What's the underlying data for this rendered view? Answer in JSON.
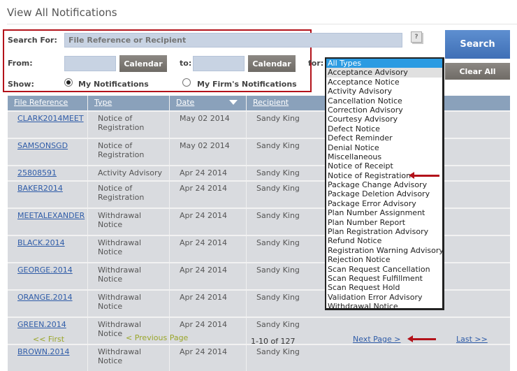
{
  "page": {
    "title": "View All Notifications"
  },
  "search": {
    "search_for_label": "Search For:",
    "placeholder": "File Reference or Recipient",
    "value": "",
    "help_label": "?",
    "from_label": "From:",
    "from_value": "",
    "to_label": "to:",
    "to_value": "",
    "calendar_label": "Calendar",
    "for_label": "for:",
    "show_label": "Show:",
    "show_options": [
      {
        "label": "My Notifications",
        "selected": true
      },
      {
        "label": "My Firm's Notifications",
        "selected": false
      }
    ],
    "search_button": "Search",
    "clear_button": "Clear All"
  },
  "type_dropdown": {
    "selected": "All Types",
    "hovered": "Acceptance Advisory",
    "annotated": "Notice of Registration",
    "options": [
      "All Types",
      "Acceptance Advisory",
      "Acceptance Notice",
      "Activity Advisory",
      "Cancellation Notice",
      "Correction Advisory",
      "Courtesy Advisory",
      "Defect Notice",
      "Defect Reminder",
      "Denial Notice",
      "Miscellaneous",
      "Notice of Receipt",
      "Notice of Registration",
      "Package Change Advisory",
      "Package Deletion Advisory",
      "Package Error Advisory",
      "Plan Number Assignment",
      "Plan Number Report",
      "Plan Registration Advisory",
      "Refund Notice",
      "Registration Warning Advisory",
      "Rejection Notice",
      "Scan Request Cancellation",
      "Scan Request Fulfillment",
      "Scan Request Hold",
      "Validation Error Advisory",
      "Withdrawal Notice"
    ]
  },
  "table": {
    "columns": [
      "File Reference",
      "Type",
      "Date",
      "Recipient"
    ],
    "sorted_by": "Date",
    "sort_direction": "descending",
    "rows": [
      {
        "ref": "CLARK2014MEET",
        "type": [
          "Notice of",
          "Registration"
        ],
        "date": "May 02 2014",
        "recipient": "Sandy King"
      },
      {
        "ref": "SAMSONSGD",
        "type": [
          "Notice of",
          "Registration"
        ],
        "date": "May 02 2014",
        "recipient": "Sandy King"
      },
      {
        "ref": "25808591",
        "type": [
          "Activity Advisory"
        ],
        "date": "Apr 24 2014",
        "recipient": "Sandy King"
      },
      {
        "ref": "BAKER2014",
        "type": [
          "Notice of",
          "Registration"
        ],
        "date": "Apr 24 2014",
        "recipient": "Sandy King"
      },
      {
        "ref": "MEETALEXANDER",
        "type": [
          "Withdrawal",
          "Notice"
        ],
        "date": "Apr 24 2014",
        "recipient": "Sandy King"
      },
      {
        "ref": "BLACK.2014",
        "type": [
          "Withdrawal",
          "Notice"
        ],
        "date": "Apr 24 2014",
        "recipient": "Sandy King"
      },
      {
        "ref": "GEORGE.2014",
        "type": [
          "Withdrawal",
          "Notice"
        ],
        "date": "Apr 24 2014",
        "recipient": "Sandy King"
      },
      {
        "ref": "ORANGE.2014",
        "type": [
          "Withdrawal",
          "Notice"
        ],
        "date": "Apr 24 2014",
        "recipient": "Sandy King"
      },
      {
        "ref": "GREEN.2014",
        "type": [
          "Withdrawal",
          "Notice"
        ],
        "date": "Apr 24 2014",
        "recipient": "Sandy King"
      },
      {
        "ref": "BROWN.2014",
        "type": [
          "Withdrawal",
          "Notice"
        ],
        "date": "Apr 24 2014",
        "recipient": "Sandy King"
      }
    ]
  },
  "pager": {
    "first": "<< First",
    "previous": "< Previous Page",
    "count": "1-10 of 127",
    "next": "Next Page >",
    "last": "Last >>"
  },
  "colors": {
    "annotation_red": "#b3121a",
    "header_blue": "#8aa1bb",
    "link_blue": "#2f5ca8",
    "selected_option": "#2b9be2",
    "disabled_pager": "#9aa62b"
  }
}
